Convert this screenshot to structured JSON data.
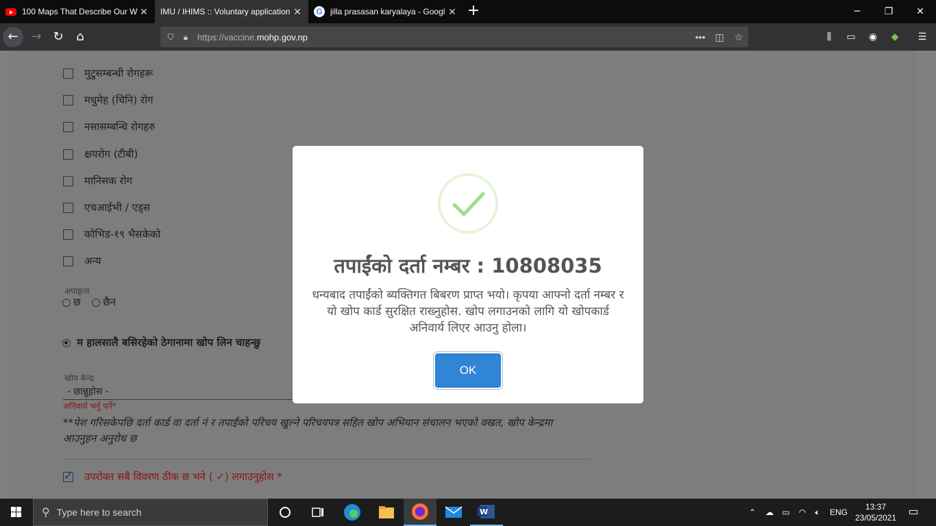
{
  "browser": {
    "tabs": [
      {
        "title": "100 Maps That Describe Our W",
        "favicon": "youtube-icon"
      },
      {
        "title": "IMU / IHIMS :: Voluntary application",
        "favicon": "none"
      },
      {
        "title": "jilla prasasan karyalaya - Googl",
        "favicon": "google-icon"
      }
    ],
    "url_prefix": "https://vaccine.",
    "url_domain": "mohp.gov.np",
    "url_more": "•••"
  },
  "form": {
    "conditions": [
      "मुटुसम्बन्धी रोगहरू",
      "मधुमेह (चिनि) रोग",
      "नसासम्बन्धि रोगहरु",
      "क्षयरोग (टीबी)",
      "मानिसक रोग",
      "एचआईभी / एड्स",
      "कोभिड-१९ भैसकेको",
      "अन्य"
    ],
    "disability_label": "अपाङ्गता",
    "disability_yes": "छ",
    "disability_no": "छैन",
    "location_question": "म हालसालै बसिरहेको ठेगानामा खोप लिन चाहन्छु",
    "center_label": "खोप केन्द्र",
    "center_select": "- छान्नुहोस -",
    "required_text": "अनिवार्य भर्नु पर्ने*",
    "note": "**पेश गरिसकेपछि दर्ता कार्ड वा दर्ता नं र तपाईंको परिचय खुल्ने परिचयपत्र सहित खोप अभियान संचालन भएको वखत, खोप केन्द्रमा आउनुहन अनुरोध छ",
    "confirm_text": "उपरोक्त सबै विवरण ठीक छ भने ( ✓) लगाउनुहोस *"
  },
  "modal": {
    "title": "तपाईंको दर्ता नम्बर : 10808035",
    "message": "धन्यबाद तपाईंको ब्यक्तिगत बिबरण प्राप्त भयो। कृपया आफ्नो दर्ता नम्बर र यो खोप कार्ड सुरक्षित राख्नुहोस. खोप लगाउनको लागि यो खोपकार्ड अनिवार्य लिएर आउनु होला।",
    "ok_label": "OK",
    "success_color": "#a5dc86",
    "button_color": "#3085d6"
  },
  "taskbar": {
    "search_placeholder": "Type here to search",
    "language": "ENG",
    "time": "13:37",
    "date": "23/05/2021"
  }
}
